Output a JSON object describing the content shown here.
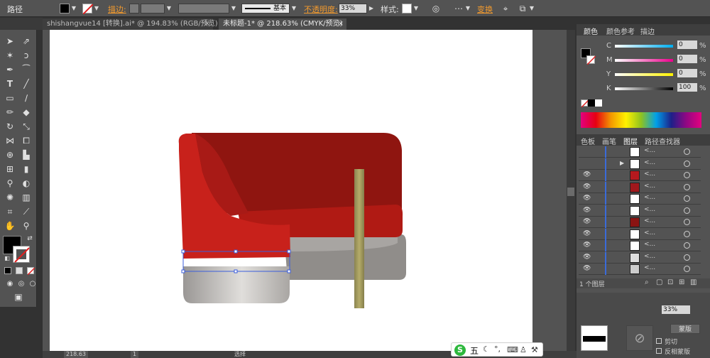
{
  "control_bar": {
    "mode_label": "路径",
    "stroke_label": "描边:",
    "stroke_profile": "基本",
    "opacity_label": "不透明度:",
    "opacity_value": "33%",
    "style_label": "样式:",
    "transform_label": "变换",
    "colors": {
      "fill": "#000000",
      "accent": "#f29a2e"
    }
  },
  "doc_tabs": [
    {
      "label": "shishangvue14 [转换].ai* @ 194.83% (RGB/预览)",
      "close": "×",
      "active": false
    },
    {
      "label": "未标题-1* @ 218.63% (CMYK/预览)",
      "close": "×",
      "active": true
    }
  ],
  "status_bar": {
    "zoom": "218.63",
    "page": "1",
    "tool_name": "选择"
  },
  "color_panel": {
    "tabs": [
      "颜色",
      "颜色参考",
      "描边"
    ],
    "channels": [
      {
        "label": "C",
        "value": "0"
      },
      {
        "label": "M",
        "value": "0"
      },
      {
        "label": "Y",
        "value": "0"
      },
      {
        "label": "K",
        "value": "100"
      }
    ],
    "pct": "%"
  },
  "layers_panel": {
    "tabs": [
      "色板",
      "画笔",
      "图层",
      "路径查找器"
    ],
    "rows": [
      {
        "name": "<...",
        "visible": false,
        "thumb": "#ffffff",
        "disclose": false
      },
      {
        "name": "<...",
        "visible": false,
        "thumb": "#ffffff",
        "disclose": true
      },
      {
        "name": "<...",
        "visible": true,
        "thumb": "#b5191e",
        "disclose": false
      },
      {
        "name": "<...",
        "visible": true,
        "thumb": "#a0181c",
        "disclose": false
      },
      {
        "name": "<...",
        "visible": true,
        "thumb": "#ffffff",
        "disclose": false
      },
      {
        "name": "<...",
        "visible": true,
        "thumb": "#ffffff",
        "disclose": false
      },
      {
        "name": "<...",
        "visible": true,
        "thumb": "#8a1412",
        "disclose": false
      },
      {
        "name": "<...",
        "visible": true,
        "thumb": "#ffffff",
        "disclose": false
      },
      {
        "name": "<...",
        "visible": true,
        "thumb": "#ffffff",
        "disclose": false
      },
      {
        "name": "<...",
        "visible": true,
        "thumb": "#dddddd",
        "disclose": false
      },
      {
        "name": "<...",
        "visible": true,
        "thumb": "#cccccc",
        "disclose": false
      }
    ],
    "footer_label": "1 个图层"
  },
  "transparency_panel": {
    "opacity_value": "33%",
    "make_mask_label": "蒙版",
    "clip_label": "剪切",
    "invert_mask_label": "反相蒙版"
  },
  "ime_bar": {
    "label": "五"
  },
  "icons": [
    "selection-arrow",
    "direct-selection",
    "magic-wand",
    "lasso",
    "pen",
    "curvature",
    "type",
    "line",
    "rectangle",
    "paintbrush",
    "pencil",
    "eraser",
    "rotate",
    "scale",
    "width",
    "free-transform",
    "shape-builder",
    "perspective",
    "mesh",
    "gradient",
    "eyedropper",
    "blend",
    "symbol-sprayer",
    "column-graph",
    "artboard",
    "slice",
    "hand",
    "zoom"
  ]
}
